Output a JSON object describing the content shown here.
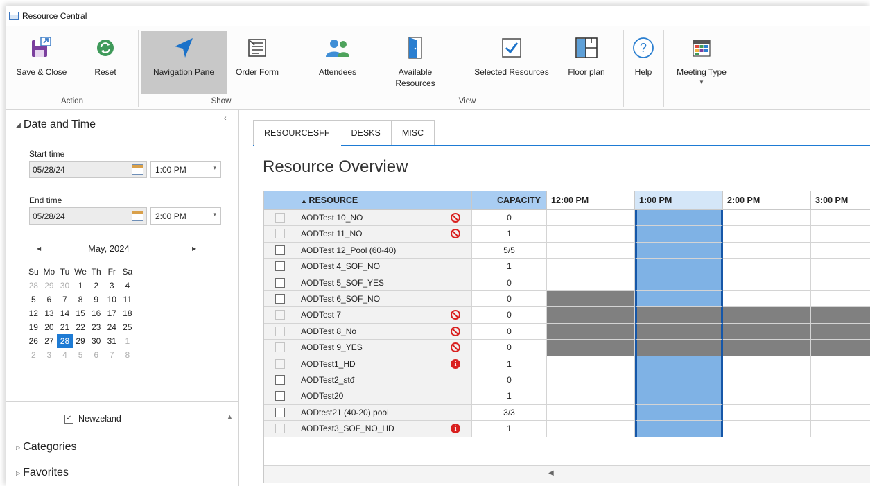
{
  "window": {
    "title": "Resource Central"
  },
  "ribbon": {
    "buttons": {
      "save_close": "Save & Close",
      "reset": "Reset",
      "navigation_pane": "Navigation Pane",
      "order_form": "Order Form",
      "attendees": "Attendees",
      "available_resources_1": "Available",
      "available_resources_2": "Resources",
      "selected_resources": "Selected Resources",
      "floor_plan": "Floor plan",
      "help": "Help",
      "meeting_type": "Meeting Type"
    },
    "groups": {
      "action": "Action",
      "show": "Show",
      "view": "View"
    }
  },
  "nav": {
    "date_time_header": "Date and Time",
    "start_label": "Start time",
    "start_date": "05/28/24",
    "start_time": "1:00 PM",
    "end_label": "End time",
    "end_date": "05/28/24",
    "end_time": "2:00 PM",
    "calendar": {
      "month": "May, 2024",
      "prev": "◀",
      "next": "▶",
      "days": [
        "Su",
        "Mo",
        "Tu",
        "We",
        "Th",
        "Fr",
        "Sa"
      ],
      "weeks": [
        [
          [
            "28",
            true
          ],
          [
            "29",
            true
          ],
          [
            "30",
            true
          ],
          [
            "1",
            false
          ],
          [
            "2",
            false
          ],
          [
            "3",
            false
          ],
          [
            "4",
            false
          ]
        ],
        [
          [
            "5",
            false
          ],
          [
            "6",
            false
          ],
          [
            "7",
            false
          ],
          [
            "8",
            false
          ],
          [
            "9",
            false
          ],
          [
            "10",
            false
          ],
          [
            "11",
            false
          ]
        ],
        [
          [
            "12",
            false
          ],
          [
            "13",
            false
          ],
          [
            "14",
            false
          ],
          [
            "15",
            false
          ],
          [
            "16",
            false
          ],
          [
            "17",
            false
          ],
          [
            "18",
            false
          ]
        ],
        [
          [
            "19",
            false
          ],
          [
            "20",
            false
          ],
          [
            "21",
            false
          ],
          [
            "22",
            false
          ],
          [
            "23",
            false
          ],
          [
            "24",
            false
          ],
          [
            "25",
            false
          ]
        ],
        [
          [
            "26",
            false
          ],
          [
            "27",
            false
          ],
          [
            "28",
            false
          ],
          [
            "29",
            false
          ],
          [
            "30",
            false
          ],
          [
            "31",
            false
          ],
          [
            "1",
            true
          ]
        ],
        [
          [
            "2",
            true
          ],
          [
            "3",
            true
          ],
          [
            "4",
            true
          ],
          [
            "5",
            true
          ],
          [
            "6",
            true
          ],
          [
            "7",
            true
          ],
          [
            "8",
            true
          ]
        ]
      ],
      "selected": "28"
    },
    "location": "Newzeland",
    "categories": "Categories",
    "favorites": "Favorites"
  },
  "main": {
    "tabs": [
      "RESOURCESFF",
      "DESKS",
      "MISC"
    ],
    "active_tab": 0,
    "title": "Resource Overview",
    "columns": {
      "resource": "RESOURCE",
      "capacity": "CAPACITY"
    },
    "times": [
      "12:00 PM",
      "1:00 PM",
      "2:00 PM",
      "3:00 PM"
    ],
    "rows": [
      {
        "name": "AODTest 10_NO",
        "icon": "ban",
        "capacity": "0",
        "enabled": false,
        "busy": []
      },
      {
        "name": "AODTest 11_NO",
        "icon": "ban",
        "capacity": "1",
        "enabled": false,
        "busy": []
      },
      {
        "name": "AODTest 12_Pool (60-40)",
        "icon": "",
        "capacity": "5/5",
        "enabled": true,
        "busy": []
      },
      {
        "name": "AODTest 4_SOF_NO",
        "icon": "",
        "capacity": "1",
        "enabled": true,
        "busy": []
      },
      {
        "name": "AODTest 5_SOF_YES",
        "icon": "",
        "capacity": "0",
        "enabled": true,
        "busy": []
      },
      {
        "name": "AODTest 6_SOF_NO",
        "icon": "",
        "capacity": "0",
        "enabled": true,
        "busy": [
          0
        ]
      },
      {
        "name": "AODTest 7",
        "icon": "ban",
        "capacity": "0",
        "enabled": false,
        "busy": [
          0,
          1,
          2,
          3
        ]
      },
      {
        "name": "AODTest 8_No",
        "icon": "ban",
        "capacity": "0",
        "enabled": false,
        "busy": [
          0,
          1,
          2,
          3
        ]
      },
      {
        "name": "AODTest 9_YES",
        "icon": "ban",
        "capacity": "0",
        "enabled": false,
        "busy": [
          0,
          1,
          2,
          3
        ]
      },
      {
        "name": "AODTest1_HD",
        "icon": "info",
        "capacity": "1",
        "enabled": false,
        "busy": []
      },
      {
        "name": "AODTest2_stđ",
        "icon": "",
        "capacity": "0",
        "enabled": true,
        "busy": []
      },
      {
        "name": "AODTest20",
        "icon": "",
        "capacity": "1",
        "enabled": true,
        "busy": []
      },
      {
        "name": "AODtest21 (40-20) pool",
        "icon": "",
        "capacity": "3/3",
        "enabled": true,
        "busy": []
      },
      {
        "name": "AODTest3_SOF_NO_HD",
        "icon": "info",
        "capacity": "1",
        "enabled": false,
        "busy": []
      }
    ]
  },
  "colors": {
    "accent": "#1e7bd4",
    "header_bg": "#a9cdf2",
    "selected_slot": "#7fb2e5",
    "busy": "#808080",
    "warning": "#d9201f"
  }
}
